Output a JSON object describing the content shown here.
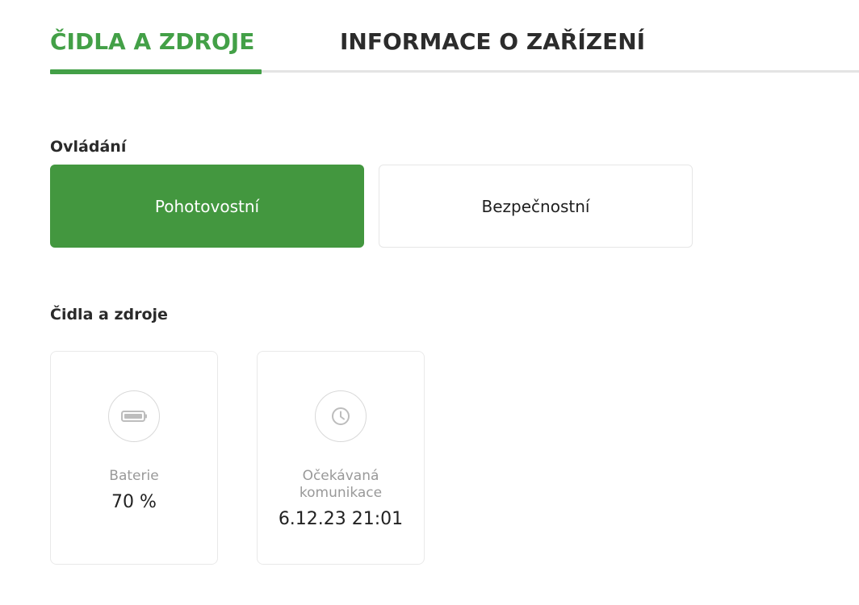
{
  "tabs": [
    {
      "label": "ČIDLA A ZDROJE",
      "active": true
    },
    {
      "label": "INFORMACE O ZAŘÍZENÍ",
      "active": false
    }
  ],
  "control": {
    "title": "Ovládání",
    "modes": [
      {
        "label": "Pohotovostní",
        "active": true
      },
      {
        "label": "Bezpečnostní",
        "active": false
      }
    ]
  },
  "sensors": {
    "title": "Čidla a zdroje",
    "cards": [
      {
        "icon": "battery-icon",
        "label": "Baterie",
        "value": "70 %"
      },
      {
        "icon": "clock-icon",
        "label_line1": "Očekávaná",
        "label_line2": "komunikace",
        "value": "6.12.23 21:01"
      }
    ]
  },
  "colors": {
    "accent": "#43a047",
    "button_active": "#43973f",
    "muted_text": "#999999",
    "border": "#e6e6e6"
  }
}
